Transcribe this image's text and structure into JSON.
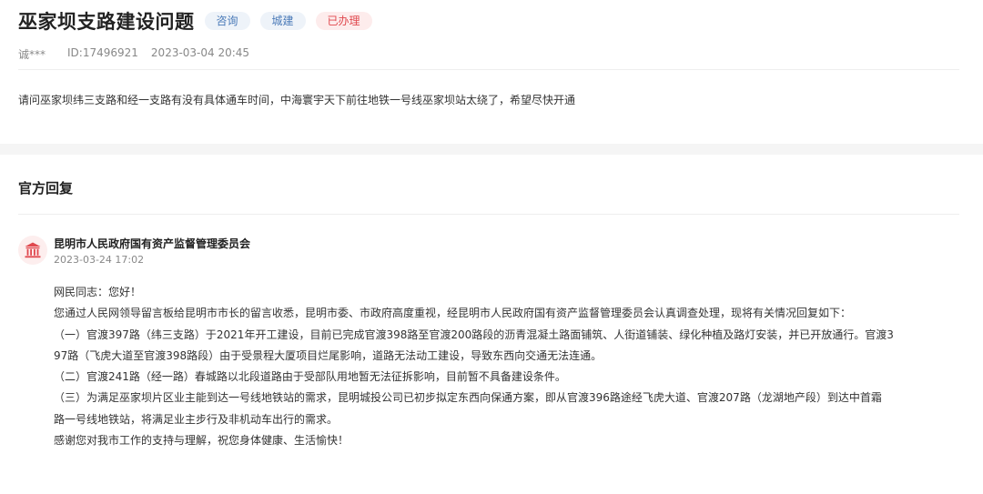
{
  "question": {
    "title": "巫家坝支路建设问题",
    "tags": [
      "咨询",
      "城建",
      "已办理"
    ],
    "user": "诚***",
    "id": "ID:17496921",
    "time": "2023-03-04 20:45",
    "content": "请问巫家坝纬三支路和经一支路有没有具体通车时间，中海寰宇天下前往地铁一号线巫家坝站太绕了，希望尽快开通"
  },
  "reply": {
    "section_title": "官方回复",
    "avatar_icon": "government-building-icon",
    "org_name": "昆明市人民政府国有资产监督管理委员会",
    "time": "2023-03-24 17:02",
    "lines": [
      "网民同志：您好！",
      "您通过人民网领导留言板给昆明市市长的留言收悉，昆明市委、市政府高度重视，经昆明市人民政府国有资产监督管理委员会认真调查处理，现将有关情况回复如下：",
      "（一）官渡397路（纬三支路）于2021年开工建设，目前已完成官渡398路至官渡200路段的沥青混凝土路面铺筑、人街道铺装、绿化种植及路灯安装，并已开放通行。官渡3",
      "97路（飞虎大道至官渡398路段）由于受景程大厦项目烂尾影响，道路无法动工建设，导致东西向交通无法连通。",
      "（二）官渡241路（经一路）春城路以北段道路由于受部队用地暂无法征拆影响，目前暂不具备建设条件。",
      "（三）为满足巫家坝片区业主能到达一号线地铁站的需求，昆明城投公司已初步拟定东西向保通方案，即从官渡396路途经飞虎大道、官渡207路（龙湖地产段）到达中首霜",
      "路一号线地铁站，将满足业主步行及非机动车出行的需求。",
      "感谢您对我市工作的支持与理解，祝您身体健康、生活愉快！"
    ]
  },
  "colors": {
    "tag_blue_bg": "#eef3f9",
    "tag_blue_text": "#4a7ab8",
    "tag_red_bg": "#fdecec",
    "tag_red_text": "#e0484e",
    "avatar_icon": "#e0484e"
  }
}
